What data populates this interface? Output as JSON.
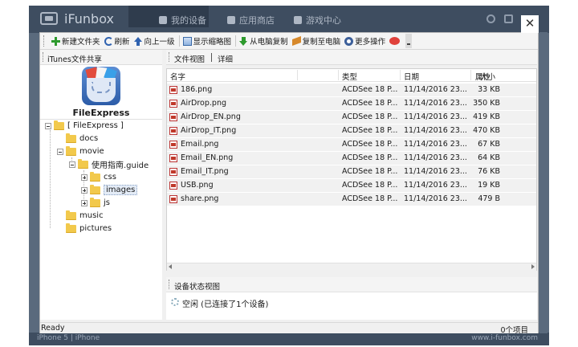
{
  "app": {
    "brand": "iFunbox",
    "nav_tabs": [
      {
        "label": "我的设备",
        "active": true
      },
      {
        "label": "应用商店",
        "active": false
      },
      {
        "label": "游戏中心",
        "active": false
      }
    ],
    "bottom_left": "iPhone 5 | iPhone",
    "bottom_right": "www.i-funbox.com"
  },
  "dialog": {
    "close_glyph": "✕",
    "toolbar": {
      "new_folder": "新建文件夹",
      "refresh": "刷新",
      "up": "向上一级",
      "thumbnails": "显示缩略图",
      "copy_from_pc": "从电脑复制",
      "copy_to_pc": "复制至电脑",
      "more": "更多操作"
    },
    "left": {
      "header": "iTunes文件共享",
      "app_name": "FileExpress",
      "tree": [
        {
          "label": "[ FileExpress ]",
          "level": 0,
          "toggle": "minus"
        },
        {
          "label": "docs",
          "level": 1,
          "toggle": "none"
        },
        {
          "label": "movie",
          "level": 1,
          "toggle": "minus"
        },
        {
          "label": "使用指南.guide",
          "level": 2,
          "toggle": "minus"
        },
        {
          "label": "css",
          "level": 3,
          "toggle": "plus"
        },
        {
          "label": "images",
          "level": 3,
          "toggle": "plus",
          "selected": true
        },
        {
          "label": "js",
          "level": 3,
          "toggle": "plus"
        },
        {
          "label": "music",
          "level": 1,
          "toggle": "none"
        },
        {
          "label": "pictures",
          "level": 1,
          "toggle": "none"
        }
      ]
    },
    "right": {
      "view_tab_1": "文件视图",
      "view_tab_2": "详细",
      "columns": {
        "name": "名字",
        "size": "大小",
        "type": "类型",
        "date": "日期",
        "attr": "属性"
      },
      "files": [
        {
          "name": "186.png",
          "size": "33 KB",
          "type": "ACDSee 18 P...",
          "date": "11/14/2016  23..."
        },
        {
          "name": "AirDrop.png",
          "size": "350 KB",
          "type": "ACDSee 18 P...",
          "date": "11/14/2016  23..."
        },
        {
          "name": "AirDrop_EN.png",
          "size": "419 KB",
          "type": "ACDSee 18 P...",
          "date": "11/14/2016  23..."
        },
        {
          "name": "AirDrop_IT.png",
          "size": "470 KB",
          "type": "ACDSee 18 P...",
          "date": "11/14/2016  23..."
        },
        {
          "name": "Email.png",
          "size": "67 KB",
          "type": "ACDSee 18 P...",
          "date": "11/14/2016  23..."
        },
        {
          "name": "Email_EN.png",
          "size": "64 KB",
          "type": "ACDSee 18 P...",
          "date": "11/14/2016  23..."
        },
        {
          "name": "Email_IT.png",
          "size": "76 KB",
          "type": "ACDSee 18 P...",
          "date": "11/14/2016  23..."
        },
        {
          "name": "USB.png",
          "size": "19 KB",
          "type": "ACDSee 18 P...",
          "date": "11/14/2016  23..."
        },
        {
          "name": "share.png",
          "size": "479 B",
          "type": "ACDSee 18 P...",
          "date": "11/14/2016  23..."
        }
      ],
      "status_header": "设备状态视图",
      "status_text": "空闲 (已连接了1个设备)"
    },
    "statusbar": {
      "left": "Ready",
      "right": "0个项目"
    }
  }
}
